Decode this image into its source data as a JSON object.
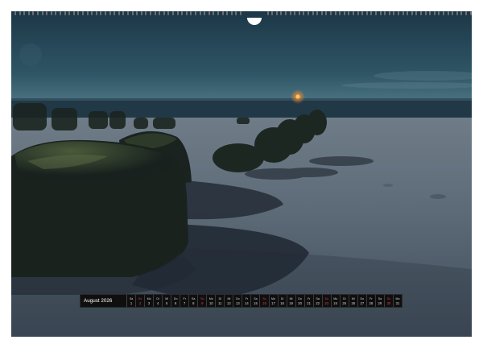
{
  "calendar": {
    "month_label": "August 2026",
    "days": [
      {
        "wd": "Sa",
        "d": "1",
        "sun": false
      },
      {
        "wd": "So",
        "d": "2",
        "sun": true
      },
      {
        "wd": "Mo",
        "d": "3",
        "sun": false
      },
      {
        "wd": "Di",
        "d": "4",
        "sun": false
      },
      {
        "wd": "Mi",
        "d": "5",
        "sun": false
      },
      {
        "wd": "Do",
        "d": "6",
        "sun": false
      },
      {
        "wd": "Fr",
        "d": "7",
        "sun": false
      },
      {
        "wd": "Sa",
        "d": "8",
        "sun": false
      },
      {
        "wd": "So",
        "d": "9",
        "sun": true
      },
      {
        "wd": "Mo",
        "d": "10",
        "sun": false
      },
      {
        "wd": "Di",
        "d": "11",
        "sun": false
      },
      {
        "wd": "Mi",
        "d": "12",
        "sun": false
      },
      {
        "wd": "Do",
        "d": "13",
        "sun": false
      },
      {
        "wd": "Fr",
        "d": "14",
        "sun": false
      },
      {
        "wd": "Sa",
        "d": "15",
        "sun": false
      },
      {
        "wd": "So",
        "d": "16",
        "sun": true
      },
      {
        "wd": "Mo",
        "d": "17",
        "sun": false
      },
      {
        "wd": "Di",
        "d": "18",
        "sun": false
      },
      {
        "wd": "Mi",
        "d": "19",
        "sun": false
      },
      {
        "wd": "Do",
        "d": "20",
        "sun": false
      },
      {
        "wd": "Fr",
        "d": "21",
        "sun": false
      },
      {
        "wd": "Sa",
        "d": "22",
        "sun": false
      },
      {
        "wd": "So",
        "d": "23",
        "sun": true
      },
      {
        "wd": "Mo",
        "d": "24",
        "sun": false
      },
      {
        "wd": "Di",
        "d": "25",
        "sun": false
      },
      {
        "wd": "Mi",
        "d": "26",
        "sun": false
      },
      {
        "wd": "Do",
        "d": "27",
        "sun": false
      },
      {
        "wd": "Fr",
        "d": "28",
        "sun": false
      },
      {
        "wd": "Sa",
        "d": "29",
        "sun": false
      },
      {
        "wd": "So",
        "d": "30",
        "sun": true
      },
      {
        "wd": "Mo",
        "d": "31",
        "sun": false
      }
    ]
  },
  "colors": {
    "sky_top": "#1e3a4a",
    "sky_horizon": "#3c6070",
    "sea": "#1f3644",
    "sand": "#5a6a78",
    "rock": "#1c2620",
    "sunday": "#d94040"
  }
}
